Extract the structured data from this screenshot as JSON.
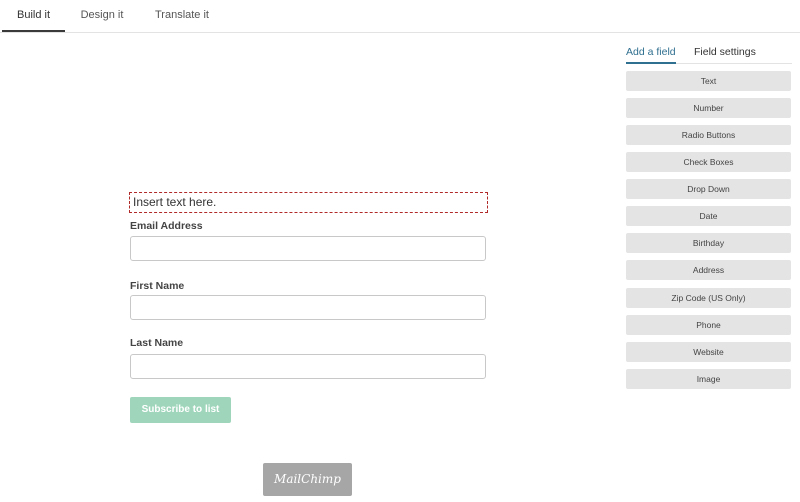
{
  "top_tabs": {
    "build": "Build it",
    "design": "Design it",
    "translate": "Translate it"
  },
  "form": {
    "insert_text": "Insert text here.",
    "email_label": "Email Address",
    "first_name_label": "First Name",
    "last_name_label": "Last Name",
    "subscribe_label": "Subscribe to list",
    "logo_text": "MailChimp"
  },
  "panel": {
    "tab_add": "Add a field",
    "tab_settings": "Field settings",
    "fields": [
      "Text",
      "Number",
      "Radio Buttons",
      "Check Boxes",
      "Drop Down",
      "Date",
      "Birthday",
      "Address",
      "Zip Code (US Only)",
      "Phone",
      "Website",
      "Image"
    ]
  },
  "colors": {
    "active_tab": "#2f6f8f",
    "subscribe_button": "#9fd6bb",
    "field_button": "#e4e4e4",
    "insert_border": "#b02a2a"
  }
}
